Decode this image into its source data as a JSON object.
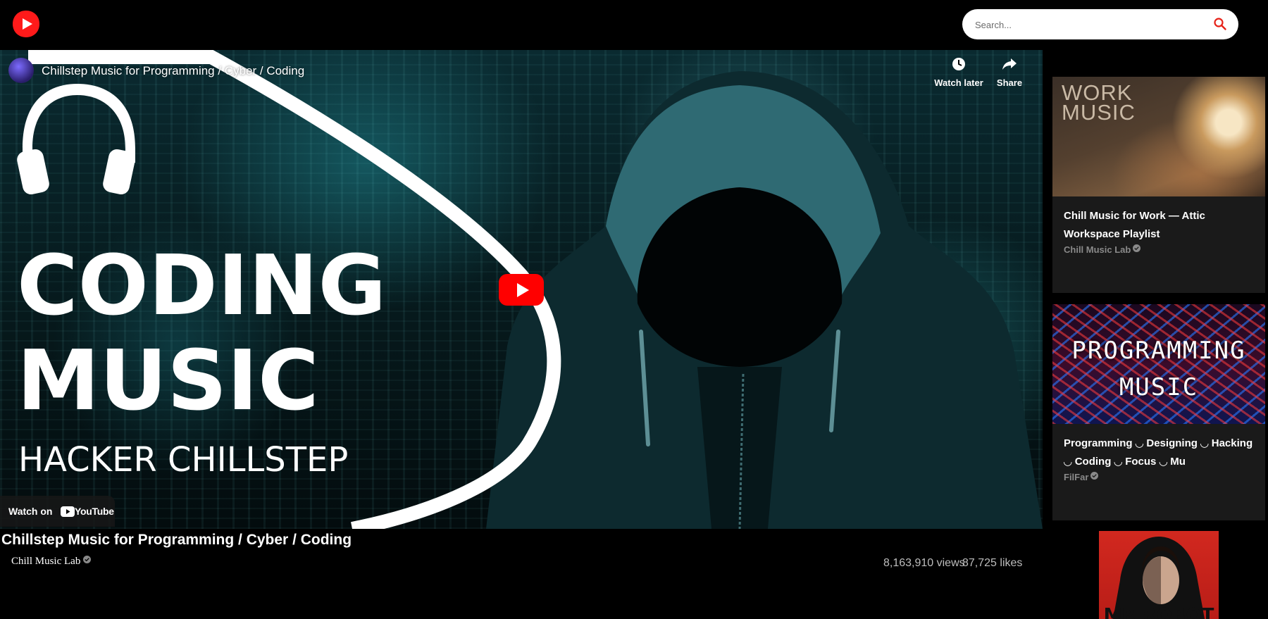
{
  "header": {
    "search_placeholder": "Search..."
  },
  "player": {
    "title": "Chillstep Music for Programming / Cyber / Coding",
    "thumbnail_text": {
      "line1": "CODING",
      "line2": "MUSIC",
      "line3": "HACKER CHILLSTEP"
    },
    "watch_later_label": "Watch later",
    "share_label": "Share",
    "watch_on_label": "Watch on",
    "youtube_wordmark": "YouTube"
  },
  "video": {
    "title": "Chillstep Music for Programming / Cyber / Coding",
    "channel": "Chill Music Lab",
    "views": "8,163,910 views",
    "likes": "87,725 likes"
  },
  "sidebar": {
    "items": [
      {
        "thumb_text": "WORK MUSIC",
        "title": "Chill Music for Work — Attic Workspace Playlist",
        "channel": "Chill Music Lab"
      },
      {
        "thumb_text": "PROGRAMMING MUSIC",
        "title": "Programming ◡ Designing ◡ Hacking ◡ Coding ◡ Focus ◡ Mu",
        "channel": "FilFar"
      },
      {
        "thumb_text": "MR ROBOT"
      }
    ]
  },
  "colors": {
    "background": "#000000",
    "accent_red": "#ff0000",
    "card_bg": "#1a1a1a",
    "muted_text": "#8a8a8a"
  }
}
